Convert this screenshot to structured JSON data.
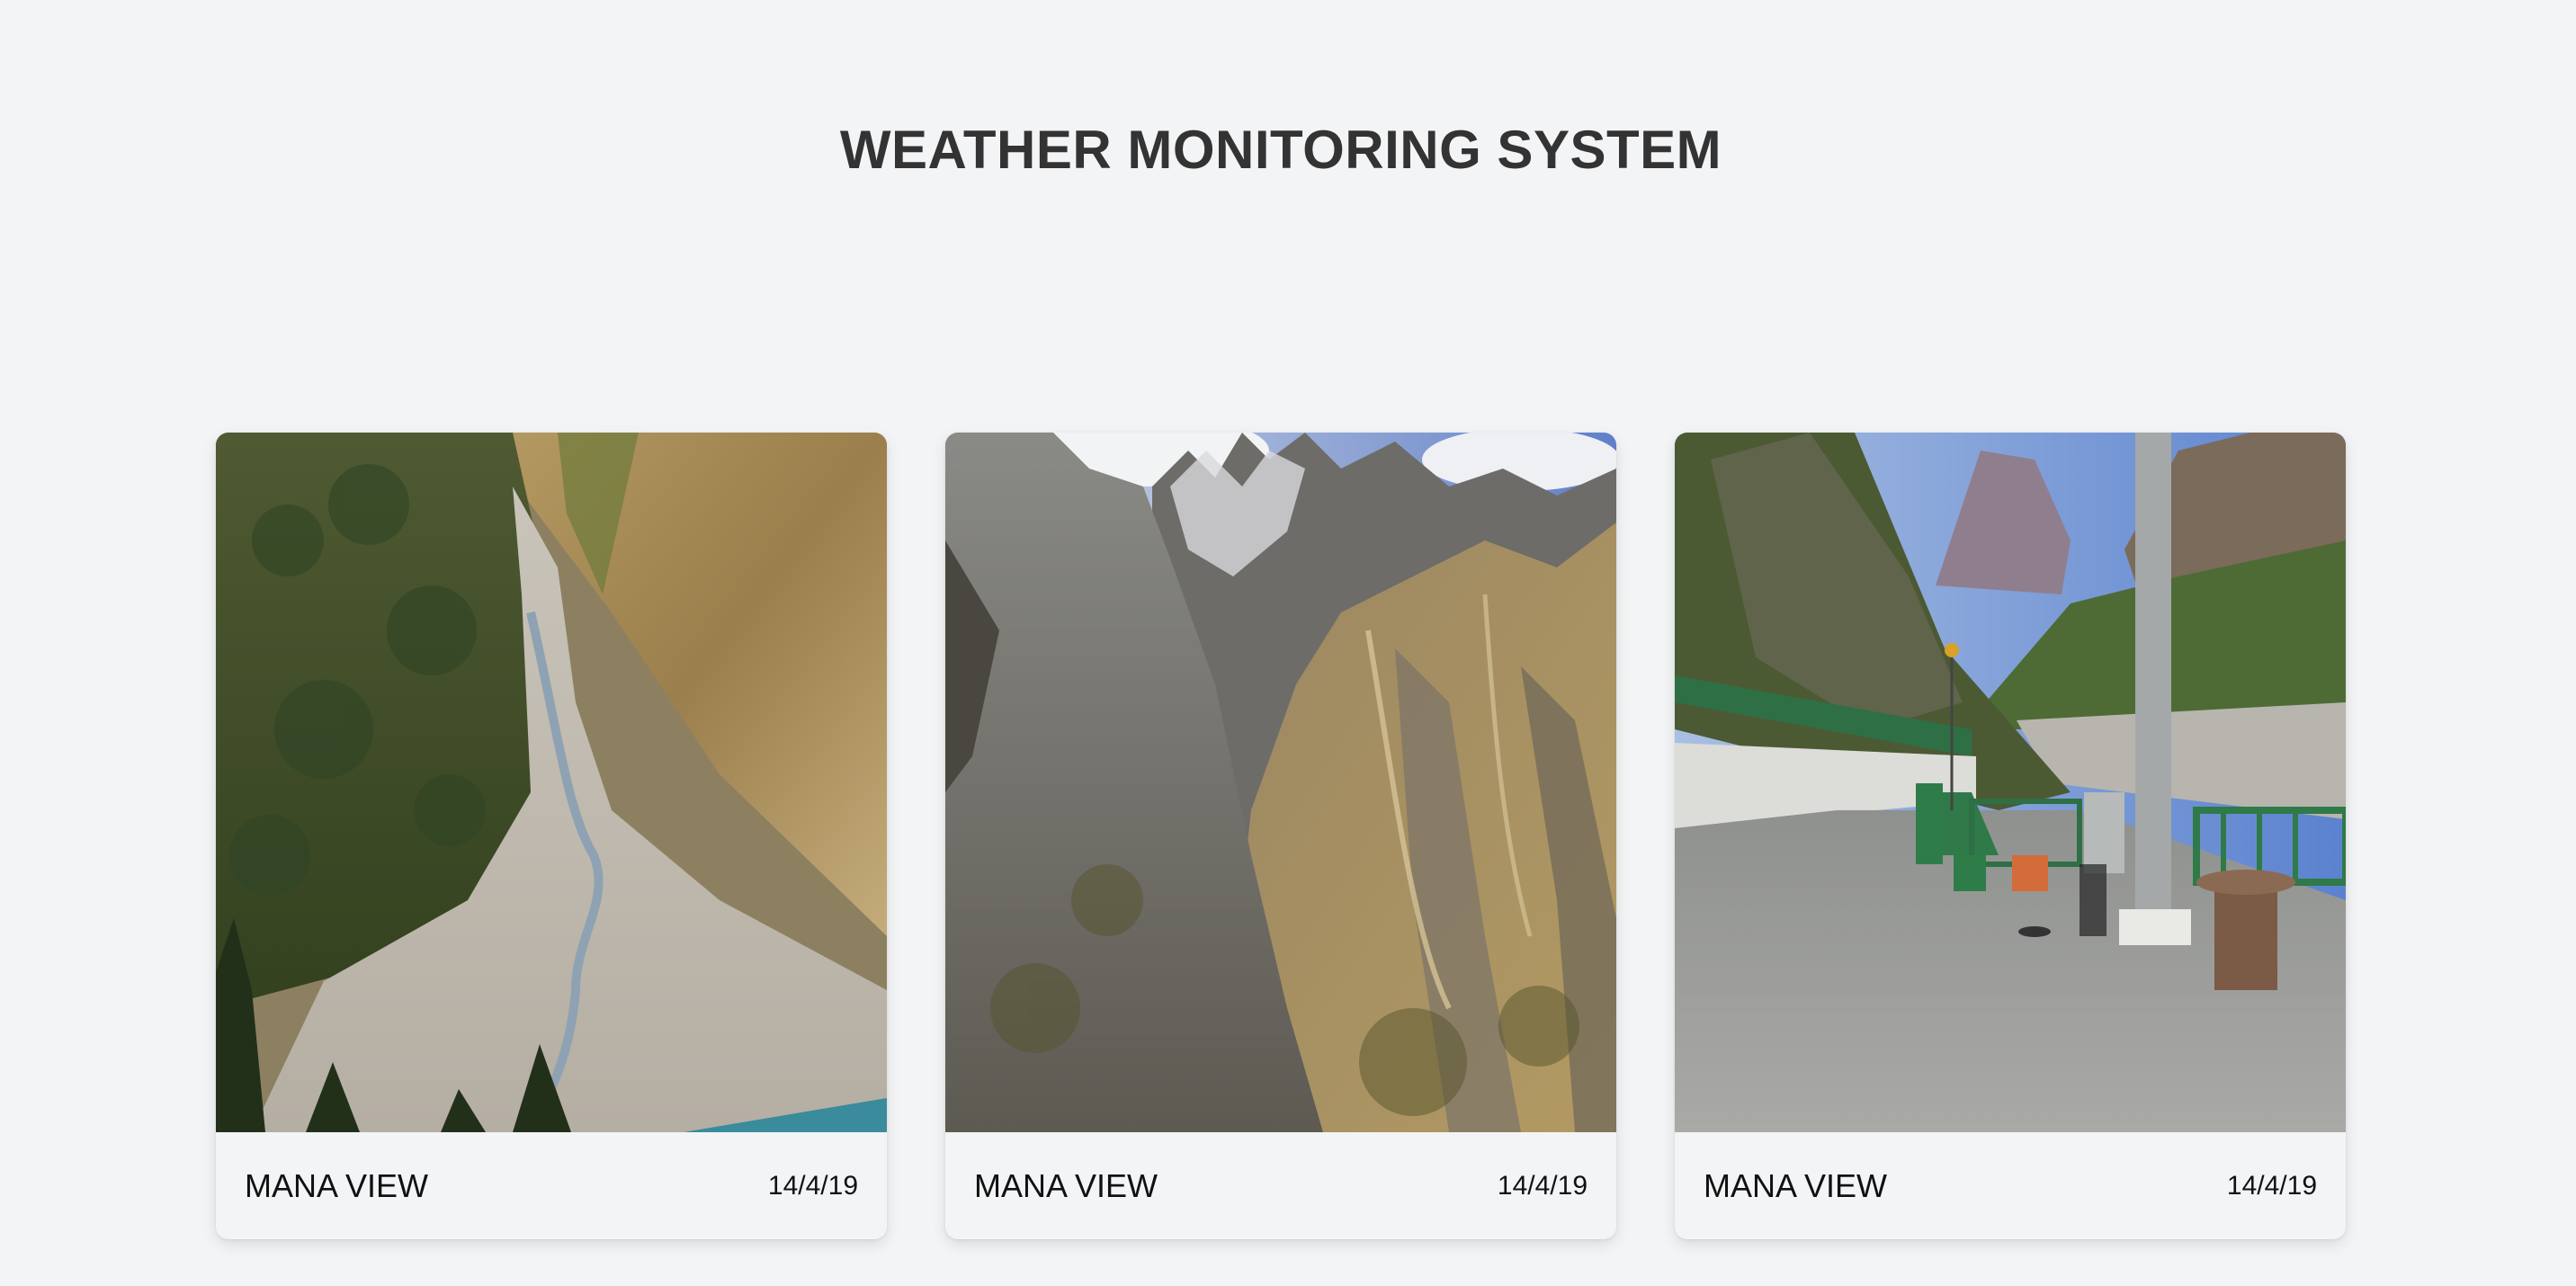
{
  "page": {
    "title": "WEATHER MONITORING SYSTEM"
  },
  "cards": [
    {
      "name": "MANA VIEW",
      "date": "14/4/19",
      "image": "river-valley-photo"
    },
    {
      "name": "MANA VIEW",
      "date": "14/4/19",
      "image": "rocky-peaks-photo"
    },
    {
      "name": "MANA VIEW",
      "date": "14/4/19",
      "image": "weather-station-photo"
    }
  ],
  "colors": {
    "background": "#f3f4f6",
    "title": "#333333",
    "text": "#111111"
  }
}
